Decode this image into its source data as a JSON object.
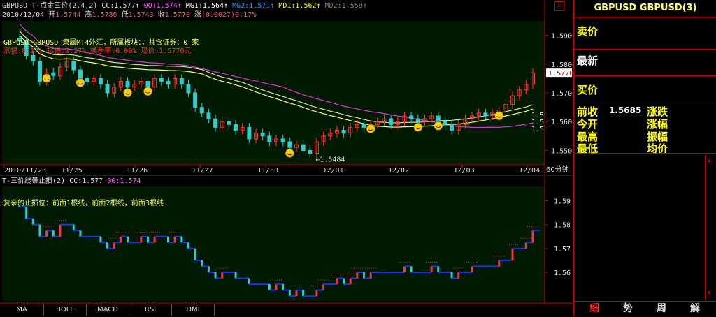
{
  "main_header": {
    "symbol": "GBPUSD",
    "indicator": "T-点金三价(2,4,2)",
    "items": [
      {
        "text": "CC:1.577",
        "color": "#e0e0e0"
      },
      {
        "text": "00:1.574",
        "color": "#ff66ff"
      },
      {
        "text": "MG1:1.564",
        "color": "#ffffff"
      },
      {
        "text": "MG2:1.571",
        "color": "#3399ff"
      },
      {
        "text": "MD1:1.562",
        "color": "#ffff00"
      },
      {
        "text": "MD2:1.559",
        "color": "#808080"
      }
    ]
  },
  "quote_line": {
    "date": "2010/12/04",
    "open_label": "开",
    "open": "1.5744",
    "high_label": "高",
    "high": "1.5786",
    "low_label": "低",
    "low": "1.5743",
    "close_label": "收",
    "close": "1.5770",
    "change_label": "涨",
    "change": "(0.0027)",
    "change_pct": "0.17%"
  },
  "info_overlay": {
    "line1": "GBPUSD GBPUSD 隶属MT4外汇，所属板块：，共含证券：0 家",
    "line2": "涨幅:0.17% 振幅:0.27% 换手率:0.00% 现价:1.5770元"
  },
  "price_axis": {
    "ticks": [
      "1.5900",
      "1.5800",
      "1.5700",
      "1.5600",
      "1.5500"
    ],
    "current": "1.5770",
    "right_labels": [
      "1.5",
      "1.5",
      "1.5"
    ],
    "low_label": "1.5484"
  },
  "date_axis": {
    "dates": [
      "2010/11/23",
      "11/25",
      "11/26",
      "11/27",
      "11/30",
      "12/01",
      "12/02",
      "12/03",
      "12/04"
    ],
    "period": "60分钟"
  },
  "sub_header": {
    "indicator": "T-三价线带止损(2)",
    "cc": "CC:1.577",
    "oo": "00:1.574"
  },
  "sub_overlay": "复杂的止损位：前面1根线，前面2根线，前面3根线",
  "sub_axis": {
    "ticks": [
      "1.59",
      "1.58",
      "1.57",
      "1.56"
    ]
  },
  "bottom_tabs": [
    "MA",
    "BOLL",
    "MACD",
    "RSI",
    "DMI"
  ],
  "side_panel": {
    "title": "GBPUSD GBPUSD(3)",
    "sell_label": "卖价",
    "latest_label": "最新",
    "buy_label": "买价",
    "stats": [
      {
        "label": "前收",
        "value": "1.5685",
        "label2": "涨跌"
      },
      {
        "label": "今开",
        "value": "",
        "label2": "涨幅"
      },
      {
        "label": "最高",
        "value": "",
        "label2": "振幅"
      },
      {
        "label": "最低",
        "value": "",
        "label2": "均价"
      }
    ],
    "tabs": [
      "细",
      "势",
      "周",
      "解"
    ]
  },
  "colors": {
    "chart_bg": "#001a00",
    "up": "#ff3333",
    "down": "#33cccc",
    "ma_purple": "#dd33dd",
    "ma_yellow": "#ffff66",
    "ma_white": "#ffffff",
    "sub_blue": "#1133ff"
  },
  "chart_data": {
    "type": "candlestick",
    "ylim": [
      1.545,
      1.595
    ],
    "close_series": [
      1.588,
      1.583,
      1.581,
      1.574,
      1.577,
      1.576,
      1.579,
      1.581,
      1.578,
      1.575,
      1.574,
      1.575,
      1.573,
      1.57,
      1.572,
      1.574,
      1.572,
      1.573,
      1.574,
      1.572,
      1.575,
      1.574,
      1.573,
      1.575,
      1.573,
      1.57,
      1.565,
      1.563,
      1.561,
      1.558,
      1.56,
      1.559,
      1.557,
      1.558,
      1.554,
      1.556,
      1.555,
      1.553,
      1.554,
      1.553,
      1.551,
      1.552,
      1.55,
      1.549,
      1.553,
      1.555,
      1.556,
      1.557,
      1.556,
      1.558,
      1.559,
      1.558,
      1.559,
      1.56,
      1.561,
      1.559,
      1.56,
      1.562,
      1.561,
      1.56,
      1.561,
      1.562,
      1.56,
      1.559,
      1.557,
      1.559,
      1.561,
      1.562,
      1.563,
      1.562,
      1.563,
      1.564,
      1.566,
      1.569,
      1.571,
      1.573,
      1.577
    ]
  }
}
